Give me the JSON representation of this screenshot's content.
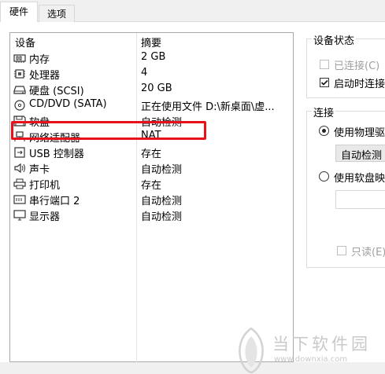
{
  "tabs": [
    {
      "label": "硬件"
    },
    {
      "label": "选项"
    }
  ],
  "device_list": {
    "header": {
      "device": "设备",
      "summary": "摘要"
    },
    "rows": [
      {
        "name": "内存",
        "summary": "2 GB",
        "icon": "memory-icon"
      },
      {
        "name": "处理器",
        "summary": "4",
        "icon": "cpu-icon"
      },
      {
        "name": "硬盘 (SCSI)",
        "summary": "20 GB",
        "icon": "hard-disk-icon"
      },
      {
        "name": "CD/DVD (SATA)",
        "summary": "正在使用文件 D:\\新桌面\\虚...",
        "icon": "cd-dvd-icon"
      },
      {
        "name": "软盘",
        "summary": "自动检测",
        "icon": "floppy-icon"
      },
      {
        "name": "网络适配器",
        "summary": "NAT",
        "icon": "network-adapter-icon"
      },
      {
        "name": "USB 控制器",
        "summary": "存在",
        "icon": "usb-icon"
      },
      {
        "name": "声卡",
        "summary": "自动检测",
        "icon": "sound-card-icon"
      },
      {
        "name": "打印机",
        "summary": "存在",
        "icon": "printer-icon"
      },
      {
        "name": "串行端口 2",
        "summary": "自动检测",
        "icon": "serial-port-icon"
      },
      {
        "name": "显示器",
        "summary": "自动检测",
        "icon": "display-icon"
      }
    ],
    "highlight_color": "#e8101a"
  },
  "device_status": {
    "title": "设备状态",
    "connected": {
      "label": "已连接(C)",
      "checked": false,
      "enabled": false
    },
    "connect_at_power_on": {
      "label": "启动时连接",
      "checked": true
    }
  },
  "connection": {
    "title": "连接",
    "use_physical": {
      "label": "使用物理驱",
      "selected": true
    },
    "auto_detect_value": "自动检测",
    "use_floppy_image": {
      "label": "使用软盘映",
      "selected": false
    },
    "readonly": {
      "label": "只读(E)",
      "enabled": false
    }
  },
  "watermark": {
    "brand": "当下软件园",
    "url": "www.downxia.com"
  }
}
